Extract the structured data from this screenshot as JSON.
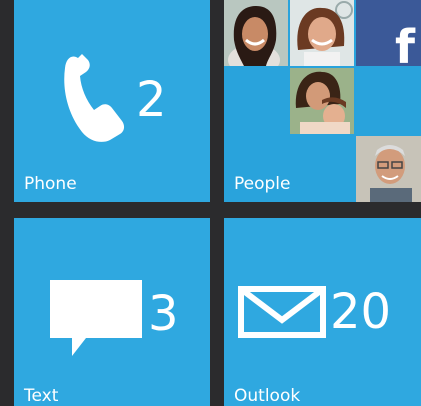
{
  "tiles": {
    "phone": {
      "label": "Phone",
      "count": "2",
      "icon": "phone-icon"
    },
    "people": {
      "label": "People",
      "facebook_glyph": "f"
    },
    "text": {
      "label": "Text",
      "count": "3",
      "icon": "message-icon"
    },
    "outlook": {
      "label": "Outlook",
      "count": "20",
      "icon": "mail-icon"
    }
  },
  "colors": {
    "tile": "#2fa8e0",
    "background": "#2b2b2d",
    "facebook": "#3b5998",
    "text": "#ffffff"
  }
}
